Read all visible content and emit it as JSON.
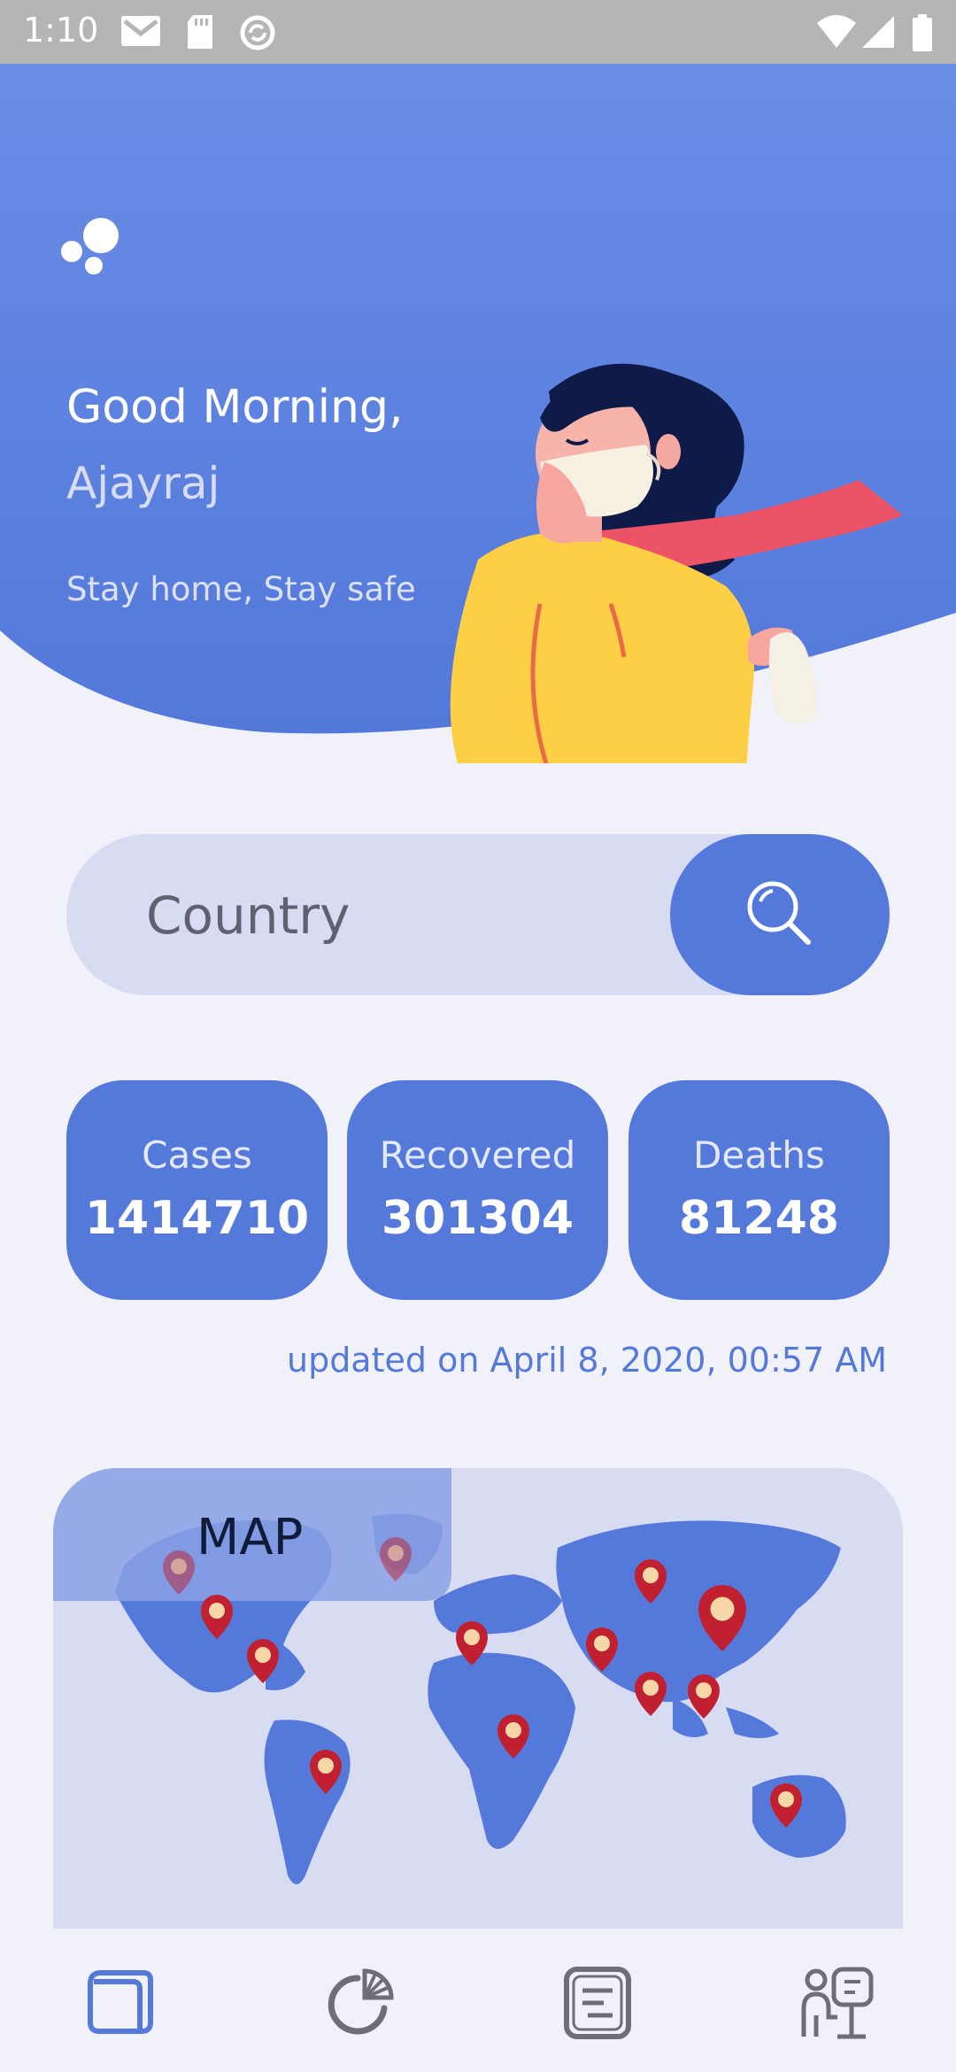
{
  "status_bar": {
    "time": "1:10"
  },
  "header": {
    "greeting": "Good Morning,",
    "user_name": "Ajayraj",
    "tagline": "Stay home, Stay safe"
  },
  "search": {
    "placeholder": "Country"
  },
  "stats": [
    {
      "label": "Cases",
      "value": "1414710"
    },
    {
      "label": "Recovered",
      "value": "301304"
    },
    {
      "label": "Deaths",
      "value": "81248"
    }
  ],
  "updated_text": "updated on April 8, 2020, 00:57 AM",
  "map": {
    "label": "MAP"
  },
  "bottom_nav": {
    "items": [
      {
        "icon": "home-cube-icon",
        "active": true
      },
      {
        "icon": "pie-chart-icon",
        "active": false
      },
      {
        "icon": "news-list-icon",
        "active": false
      },
      {
        "icon": "doctor-info-icon",
        "active": false
      }
    ]
  },
  "colors": {
    "primary": "#5479DB",
    "header_top": "#6A8DE5",
    "background": "#F1F2F9",
    "card_light": "#D8DCF3",
    "pin_red": "#C0202F"
  }
}
